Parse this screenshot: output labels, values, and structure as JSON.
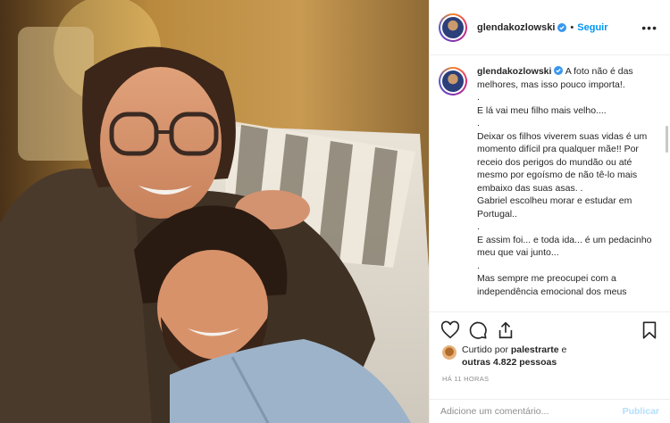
{
  "post": {
    "username": "glendakozlowski",
    "follow_label": "Seguir",
    "separator": "•",
    "more_label": "•••"
  },
  "caption": {
    "username": "glendakozlowski",
    "lines": [
      "A foto não é das melhores, mas isso pouco importa!.",
      ".",
      "E lá vai meu filho mais velho....",
      ".",
      "Deixar os filhos viverem suas vidas é um momento difícil pra qualquer mãe!! Por receio dos perigos do mundão ou até mesmo por egoísmo de não tê-lo mais embaixo das suas asas. .",
      "Gabriel escolheu morar e estudar em Portugal..",
      ".",
      "E assim foi... e toda ida... é um pedacinho meu que vai junto...",
      ".",
      "Mas sempre me preocupei com a independência emocional dos meus"
    ]
  },
  "actions": {
    "like_icon": "heart-icon",
    "comment_icon": "comment-icon",
    "share_icon": "share-icon",
    "save_icon": "bookmark-icon"
  },
  "likes": {
    "prefix": "Curtido por ",
    "first_user": "palestrarte",
    "middle": " e ",
    "others": "outras 4.822 pessoas"
  },
  "timestamp": "HÁ 11 HORAS",
  "comment": {
    "placeholder": "Adicione um comentário...",
    "publish_label": "Publicar"
  },
  "colors": {
    "accent": "#0095f6",
    "publish_disabled": "#b2dffc",
    "muted": "#8e8e8e"
  }
}
